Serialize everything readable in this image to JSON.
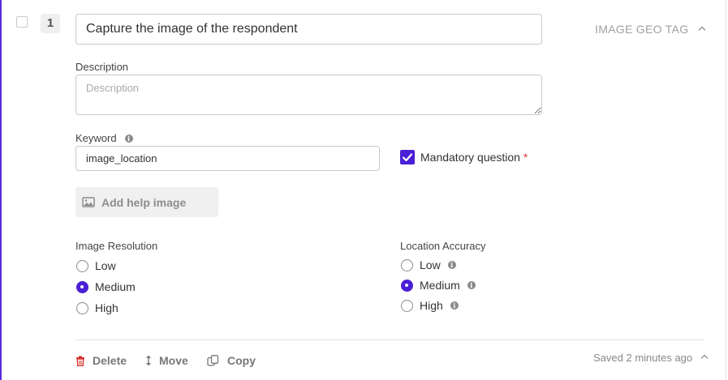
{
  "question": {
    "number": "1",
    "title": "Capture the image of the respondent",
    "type_label": "IMAGE GEO TAG"
  },
  "description": {
    "label": "Description",
    "placeholder": "Description",
    "value": ""
  },
  "keyword": {
    "label": "Keyword",
    "value": "image_location"
  },
  "mandatory": {
    "label": "Mandatory question",
    "marker": "*",
    "checked": true
  },
  "help_image": {
    "label": "Add help image"
  },
  "image_resolution": {
    "label": "Image Resolution",
    "options": [
      "Low",
      "Medium",
      "High"
    ],
    "selected": "Medium"
  },
  "location_accuracy": {
    "label": "Location Accuracy",
    "options": [
      "Low",
      "Medium",
      "High"
    ],
    "selected": "Medium"
  },
  "footer": {
    "delete_label": "Delete",
    "move_label": "Move",
    "copy_label": "Copy",
    "saved_text": "Saved 2 minutes ago"
  },
  "colors": {
    "accent": "#4a1fd6",
    "delete_icon": "#d9302c"
  }
}
